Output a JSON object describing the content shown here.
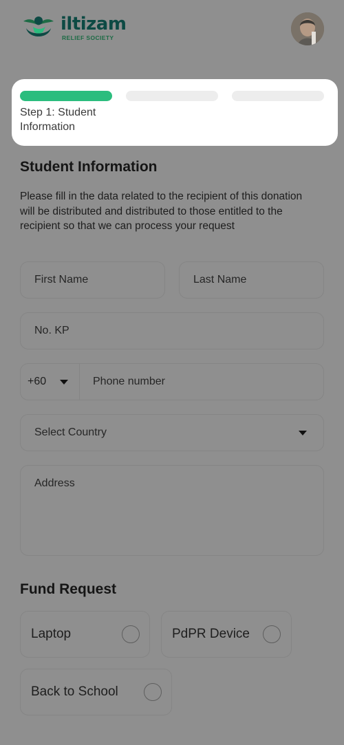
{
  "header": {
    "logo_title": "iltizam",
    "logo_subtitle": "RELIEF SOCIETY"
  },
  "progress": {
    "step_label": "Step 1: Student Information",
    "total_steps": 3,
    "current_step": 1,
    "active_color": "#2bbd7e",
    "inactive_color": "#ededed"
  },
  "student_info": {
    "title": "Student Information",
    "description": "Please fill in the data related to the recipient of this donation will be distributed and distributed to those entitled to the recipient so that we can process your request",
    "first_name_placeholder": "First Name",
    "last_name_placeholder": "Last Name",
    "kp_placeholder": "No. KP",
    "country_code": "+60",
    "phone_placeholder": "Phone number",
    "country_placeholder": "Select Country",
    "address_placeholder": "Address"
  },
  "fund_request": {
    "title": "Fund Request",
    "options": [
      "Laptop",
      "PdPR Device",
      "Back to School"
    ]
  },
  "icons": {
    "logo": "iltizam-logo-icon",
    "avatar": "user-avatar",
    "dropdown": "caret-down-icon",
    "radio": "radio-unchecked-icon"
  }
}
